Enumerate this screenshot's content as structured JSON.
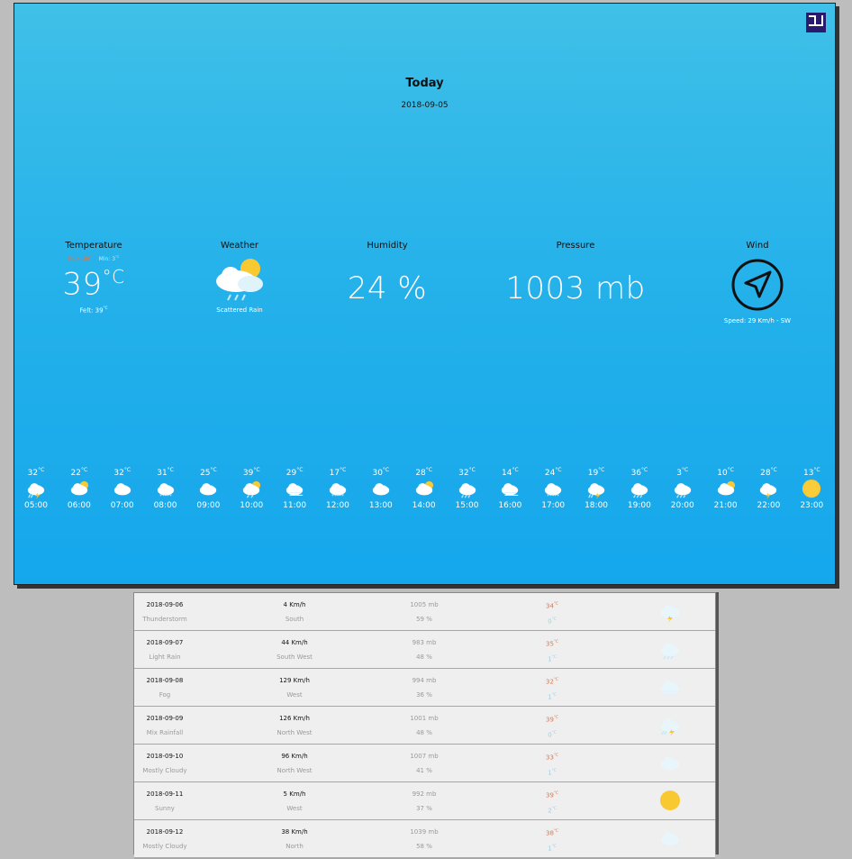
{
  "today": {
    "title": "Today",
    "date": "2018-09-05",
    "temperature": {
      "label": "Temperature",
      "value": "39",
      "unit": "°C",
      "max_text": "Max: 39",
      "min_text": "Min: 3",
      "felt_text": "Felt: 39"
    },
    "weather": {
      "label": "Weather",
      "condition": "Scattered Rain",
      "icon": "partly-cloudy-rain-icon"
    },
    "humidity": {
      "label": "Humidity",
      "value": "24 %"
    },
    "pressure": {
      "label": "Pressure",
      "value": "1003 mb"
    },
    "wind": {
      "label": "Wind",
      "speed_text": "Speed: 29 Km/h - SW",
      "icon": "wind-direction-icon"
    },
    "colors": {
      "panel_top": "#3fc0e8",
      "panel_bottom": "#15a7ec",
      "max": "#f0703e",
      "min": "#8fd4ef",
      "corner_icon": "#2a1a6e"
    }
  },
  "hourly": [
    {
      "temp": "32",
      "time": "05:00",
      "icon": "storm-rain"
    },
    {
      "temp": "22",
      "time": "06:00",
      "icon": "partly-sunny"
    },
    {
      "temp": "32",
      "time": "07:00",
      "icon": "cloud"
    },
    {
      "temp": "31",
      "time": "08:00",
      "icon": "snow"
    },
    {
      "temp": "25",
      "time": "09:00",
      "icon": "cloud"
    },
    {
      "temp": "39",
      "time": "10:00",
      "icon": "sun-cloud-rain"
    },
    {
      "temp": "29",
      "time": "11:00",
      "icon": "fog"
    },
    {
      "temp": "17",
      "time": "12:00",
      "icon": "snow"
    },
    {
      "temp": "30",
      "time": "13:00",
      "icon": "cloud"
    },
    {
      "temp": "28",
      "time": "14:00",
      "icon": "partly-sunny"
    },
    {
      "temp": "32",
      "time": "15:00",
      "icon": "rain"
    },
    {
      "temp": "14",
      "time": "16:00",
      "icon": "fog"
    },
    {
      "temp": "24",
      "time": "17:00",
      "icon": "snow"
    },
    {
      "temp": "19",
      "time": "18:00",
      "icon": "storm-rain"
    },
    {
      "temp": "36",
      "time": "19:00",
      "icon": "rain"
    },
    {
      "temp": "3",
      "time": "20:00",
      "icon": "rain"
    },
    {
      "temp": "10",
      "time": "21:00",
      "icon": "partly-sunny"
    },
    {
      "temp": "28",
      "time": "22:00",
      "icon": "storm"
    },
    {
      "temp": "13",
      "time": "23:00",
      "icon": "sun"
    }
  ],
  "forecast": [
    {
      "date": "2018-09-06",
      "condition": "Thunderstorm",
      "wind_speed": "4 Km/h",
      "wind_dir": "South",
      "pressure": "1005 mb",
      "humidity": "59 %",
      "max": "34",
      "min": "0",
      "icon": "storm"
    },
    {
      "date": "2018-09-07",
      "condition": "Light Rain",
      "wind_speed": "44 Km/h",
      "wind_dir": "South West",
      "pressure": "983 mb",
      "humidity": "48 %",
      "max": "35",
      "min": "1",
      "icon": "rain"
    },
    {
      "date": "2018-09-08",
      "condition": "Fog",
      "wind_speed": "129 Km/h",
      "wind_dir": "West",
      "pressure": "994 mb",
      "humidity": "36 %",
      "max": "32",
      "min": "1",
      "icon": "fog"
    },
    {
      "date": "2018-09-09",
      "condition": "Mix Rainfall",
      "wind_speed": "126 Km/h",
      "wind_dir": "North West",
      "pressure": "1001 mb",
      "humidity": "48 %",
      "max": "39",
      "min": "0",
      "icon": "storm-rain"
    },
    {
      "date": "2018-09-10",
      "condition": "Mostly Cloudy",
      "wind_speed": "96 Km/h",
      "wind_dir": "North West",
      "pressure": "1007 mb",
      "humidity": "41 %",
      "max": "33",
      "min": "1",
      "icon": "cloud"
    },
    {
      "date": "2018-09-11",
      "condition": "Sunny",
      "wind_speed": "5 Km/h",
      "wind_dir": "West",
      "pressure": "992 mb",
      "humidity": "37 %",
      "max": "39",
      "min": "2",
      "icon": "sun"
    },
    {
      "date": "2018-09-12",
      "condition": "Mostly Cloudy",
      "wind_speed": "38 Km/h",
      "wind_dir": "North",
      "pressure": "1039 mb",
      "humidity": "58 %",
      "max": "38",
      "min": "1",
      "icon": "cloud"
    }
  ]
}
